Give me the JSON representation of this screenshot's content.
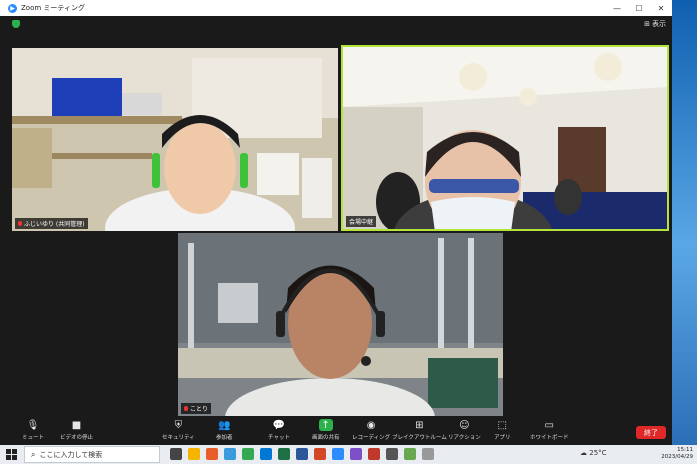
{
  "window": {
    "title": "Zoom ミーティング",
    "view_label": "表示"
  },
  "participants": [
    {
      "name": "ふじいゆり (共同管理)"
    },
    {
      "name": "会場中継"
    },
    {
      "name": "ことり"
    }
  ],
  "toolbar": {
    "items": [
      {
        "label": "ミュート",
        "icon": "microphone-icon"
      },
      {
        "label": "ビデオの停止",
        "icon": "camera-icon"
      },
      {
        "label": "セキュリティ",
        "icon": "shield-icon"
      },
      {
        "label": "参加者",
        "icon": "participants-icon",
        "count": "27"
      },
      {
        "label": "チャット",
        "icon": "chat-icon"
      },
      {
        "label": "画面の共有",
        "icon": "share-screen-icon"
      },
      {
        "label": "レコーディング",
        "icon": "record-icon"
      },
      {
        "label": "ブレイクアウトルーム",
        "icon": "breakout-icon"
      },
      {
        "label": "リアクション",
        "icon": "reaction-icon"
      },
      {
        "label": "アプリ",
        "icon": "apps-icon"
      },
      {
        "label": "ホワイトボード",
        "icon": "whiteboard-icon"
      }
    ],
    "end_label": "終了"
  },
  "taskbar": {
    "search_placeholder": "ここに入力して検索",
    "weather": "25°C",
    "time": "15:11",
    "date": "2023/04/29"
  },
  "colors": {
    "active_speaker": "#b3e43a",
    "end_button": "#e02828",
    "share_button": "#2bb24c"
  }
}
